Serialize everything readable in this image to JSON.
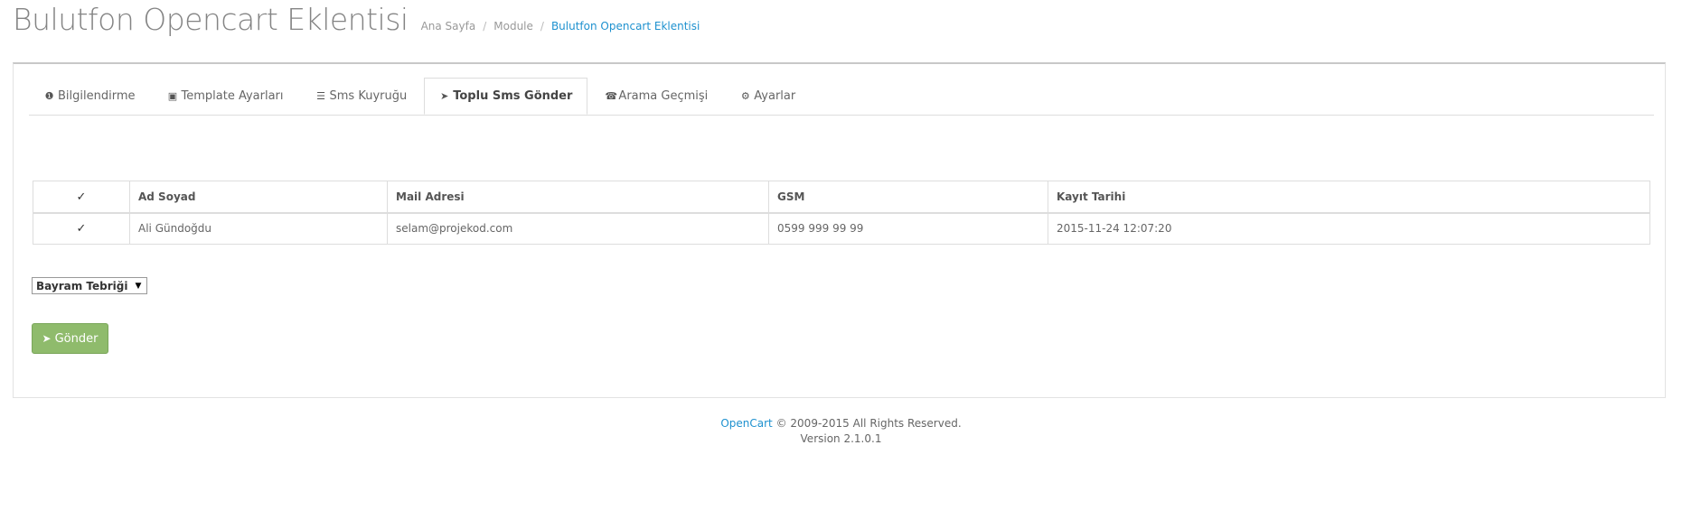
{
  "page": {
    "title": "Bulutfon Opencart Eklentisi"
  },
  "breadcrumb": [
    {
      "label": "Ana Sayfa"
    },
    {
      "label": "Module"
    },
    {
      "label": "Bulutfon Opencart Eklentisi"
    }
  ],
  "breadcrumb_separator": "/",
  "tabs": [
    {
      "label": "Bilgilendirme",
      "icon": "info-circle-icon",
      "glyph": "❶"
    },
    {
      "label": "Template Ayarları",
      "icon": "file-image-icon",
      "glyph": "▣"
    },
    {
      "label": "Sms Kuyruğu",
      "icon": "list-icon",
      "glyph": "☰"
    },
    {
      "label": "Toplu Sms Gönder",
      "icon": "paper-plane-icon",
      "glyph": "➤",
      "active": true
    },
    {
      "label": "Arama Geçmişi",
      "icon": "phone-square-icon",
      "glyph": "☎"
    },
    {
      "label": "Ayarlar",
      "icon": "cog-icon",
      "glyph": "⚙"
    }
  ],
  "table": {
    "headers": [
      "Ad Soyad",
      "Mail Adresi",
      "GSM",
      "Kayıt Tarihi"
    ],
    "header_checked": true,
    "rows": [
      {
        "checked": true,
        "name": "Ali Gündoğdu",
        "email": "selam@projekod.com",
        "gsm": "0599 999 99 99",
        "date": "2015-11-24 12:07:20"
      }
    ]
  },
  "template_select": {
    "selected": "Bayram Tebriği"
  },
  "send_button": {
    "label": "Gönder",
    "icon": "paper-plane-icon"
  },
  "footer": {
    "link": "OpenCart",
    "copyright": "© 2009-2015 All Rights Reserved.",
    "version": "Version 2.1.0.1"
  },
  "colors": {
    "accent_link": "#1e91cf",
    "success_button": "#8fbb6c"
  }
}
